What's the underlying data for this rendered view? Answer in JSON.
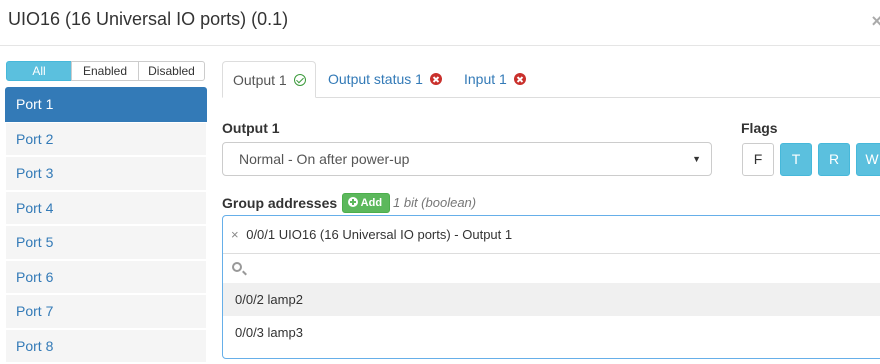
{
  "dialog": {
    "title": "UIO16 (16 Universal IO ports) (0.1)",
    "close_glyph": "×"
  },
  "filters": [
    {
      "label": "All",
      "active": true
    },
    {
      "label": "Enabled",
      "active": false
    },
    {
      "label": "Disabled",
      "active": false
    }
  ],
  "ports": [
    "Port 1",
    "Port 2",
    "Port 3",
    "Port 4",
    "Port 5",
    "Port 6",
    "Port 7",
    "Port 8"
  ],
  "tabs": [
    {
      "label": "Output 1",
      "status": "ok",
      "active": true
    },
    {
      "label": "Output status 1",
      "status": "error",
      "active": false
    },
    {
      "label": "Input 1",
      "status": "error",
      "active": false
    }
  ],
  "output": {
    "label": "Output 1",
    "selected": "Normal - On after power-up"
  },
  "flags": {
    "label": "Flags",
    "items": [
      {
        "label": "F",
        "on": false
      },
      {
        "label": "T",
        "on": true
      },
      {
        "label": "R",
        "on": true
      },
      {
        "label": "W",
        "on": true
      }
    ]
  },
  "group_addresses": {
    "label": "Group addresses",
    "add_label": "Add",
    "type_hint": "1 bit (boolean)",
    "selected_tag": "0/0/1 UIO16 (16 Universal IO ports) - Output 1",
    "remove_glyph": "×",
    "search_placeholder": "",
    "options": [
      "0/0/2 lamp2",
      "0/0/3 lamp3"
    ]
  },
  "colors": {
    "accent": "#337ab7",
    "info": "#5bc0de",
    "success": "#5cb85c",
    "danger": "#c9302c"
  }
}
